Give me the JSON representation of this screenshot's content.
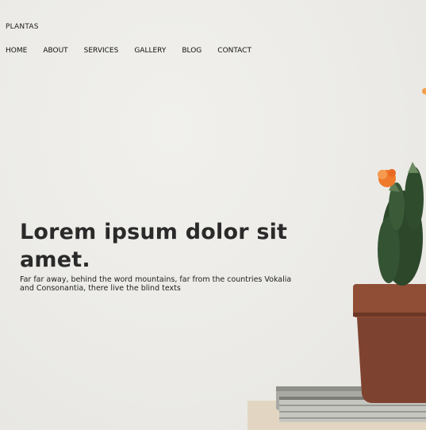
{
  "brand": {
    "logo": "PLANTAS"
  },
  "nav": {
    "items": [
      {
        "label": "HOME"
      },
      {
        "label": "ABOUT"
      },
      {
        "label": "SERVICES"
      },
      {
        "label": "GALLERY"
      },
      {
        "label": "BLOG"
      },
      {
        "label": "CONTACT"
      }
    ]
  },
  "hero": {
    "headline": "Lorem ipsum dolor sit amet.",
    "subtext": "Far far away, behind the word mountains, far from the countries Vokalia and Consonantia, there live the blind texts",
    "image_icon": "cactus-pot-on-books-image"
  },
  "colors": {
    "background": "#ecebe7",
    "text": "#222222",
    "pot": "#8a4a32",
    "cactus": "#2e4a2c",
    "flower": "#f07a2c"
  }
}
